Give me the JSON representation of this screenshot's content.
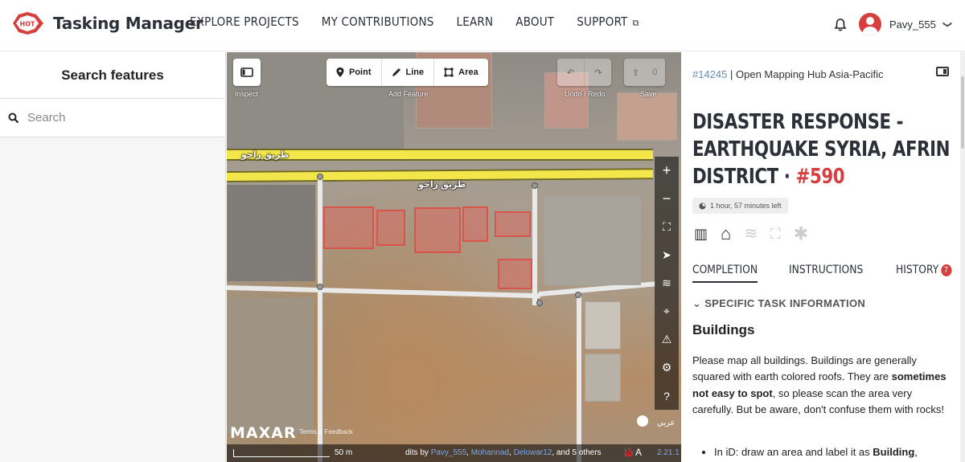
{
  "brand": {
    "name": "Tasking Manager",
    "badge": "HOT",
    "red": "#d73f3f"
  },
  "nav": {
    "items": [
      {
        "label": "EXPLORE PROJECTS"
      },
      {
        "label": "MY CONTRIBUTIONS"
      },
      {
        "label": "LEARN"
      },
      {
        "label": "ABOUT"
      },
      {
        "label": "SUPPORT",
        "external": true
      }
    ],
    "external_icon": "⧉"
  },
  "user": {
    "name": "Pavy_555",
    "caret": "❯"
  },
  "search_panel": {
    "title": "Search features",
    "placeholder": "Search"
  },
  "map": {
    "inspect_label": "Inspect",
    "add_feature_label": "Add Feature",
    "tools": [
      {
        "label": "Point",
        "icon": "pin-icon"
      },
      {
        "label": "Line",
        "icon": "pencil-icon"
      },
      {
        "label": "Area",
        "icon": "polygon-icon"
      }
    ],
    "undo_redo_label": "Undo / Redo",
    "save_label": "Save",
    "save_count": "0",
    "road_name": "طريق راجو",
    "imagery_brand": "MAXAR",
    "terms_label": "Terms & Feedback",
    "scale_label": "50 m",
    "edits_prefix": "dits by",
    "edits_users": [
      "Pavy_555",
      "Mohannad",
      "Delowar12"
    ],
    "edits_and": ", and",
    "edits_others": "5 others",
    "lang_label": "عربي",
    "version": "2.21.1"
  },
  "task": {
    "project_id": "#14245",
    "organization": "| Open Mapping Hub Asia-Pacific",
    "title": "DISASTER RESPONSE - EARTHQUAKE SYRIA, AFRIN DISTRICT ·",
    "task_number": "#590",
    "time_left": "1 hour, 57 minutes left",
    "tabs": [
      {
        "label": "COMPLETION",
        "active": true
      },
      {
        "label": "INSTRUCTIONS",
        "active": false
      },
      {
        "label": "HISTORY",
        "active": false,
        "badge": "7"
      }
    ],
    "section_toggle": "SPECIFIC TASK INFORMATION",
    "subheading": "Buildings",
    "instructions_1": "Please map all buildings. Buildings are generally squared with earth colored roofs. They are ",
    "instructions_bold": "sometimes not easy to spot",
    "instructions_2": ", so please scan the area very carefully. But be aware, don't confuse them with rocks!",
    "list_item_prefix": "In iD: draw an area and label it as ",
    "list_item_bold": "Building",
    "list_item_suffix": ","
  }
}
